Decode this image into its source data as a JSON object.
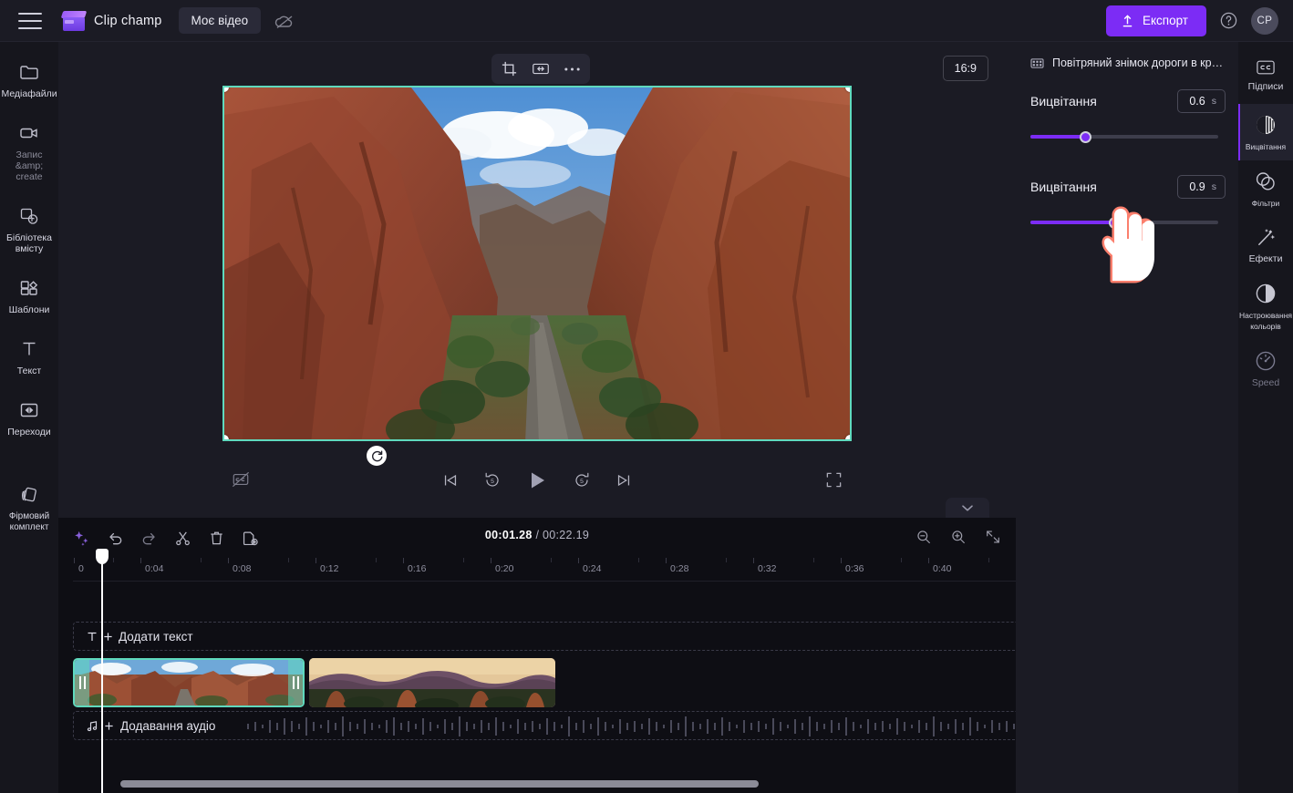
{
  "topbar": {
    "menu_icon": "hamburger-icon",
    "brand_name": "Clip champ",
    "project_name": "Моє відео",
    "cloud_icon": "cloud-off-icon",
    "export_label": "Експорт",
    "export_icon": "upload-icon",
    "help_icon": "help-circle-icon",
    "avatar_initials": "CP",
    "accent_color": "#7c2cf5"
  },
  "left_rail": {
    "items": [
      {
        "label": "Медіафайли",
        "icon": "folder-icon",
        "dim": false
      },
      {
        "label": "Запис &amp; create",
        "icon": "camera-video-icon",
        "dim": true
      },
      {
        "label": "Бібліотека вмісту",
        "icon": "content-library-icon",
        "dim": false
      },
      {
        "label": "Шаблони",
        "icon": "templates-icon",
        "dim": false
      },
      {
        "label": "Текст",
        "icon": "text-icon",
        "dim": false
      },
      {
        "label": "Переходи",
        "icon": "transitions-icon",
        "dim": false
      },
      {
        "label": "Фірмовий комплект",
        "icon": "brand-kit-icon",
        "dim": false
      }
    ],
    "expand_icon": "chevron-right-icon"
  },
  "preview": {
    "tools": [
      {
        "name": "crop-icon"
      },
      {
        "name": "fit-resize-icon"
      },
      {
        "name": "more-options-icon"
      }
    ],
    "aspect_ratio": "16:9",
    "rotate_icon": "rotate-icon",
    "captions_toggle_icon": "captions-off-icon",
    "controls": [
      {
        "name": "skip-to-start-icon"
      },
      {
        "name": "rewind-5s-icon"
      },
      {
        "name": "play-icon"
      },
      {
        "name": "forward-5s-icon"
      },
      {
        "name": "skip-to-end-icon"
      }
    ],
    "fullscreen_icon": "fullscreen-icon",
    "collapse_icon": "chevron-down-icon",
    "expand_icon": "chevron-right-icon",
    "selection_color": "#5fd9bd"
  },
  "timeline": {
    "tools_left": [
      {
        "name": "magic-ai-icon"
      },
      {
        "name": "undo-icon"
      },
      {
        "name": "redo-icon"
      },
      {
        "name": "split-scissors-icon"
      },
      {
        "name": "delete-trash-icon"
      },
      {
        "name": "duplicate-icon"
      }
    ],
    "current_time": "00:01.28",
    "separator": "/",
    "total_time": "00:22.19",
    "tools_right": [
      {
        "name": "zoom-out-icon"
      },
      {
        "name": "zoom-in-icon"
      },
      {
        "name": "fit-to-screen-icon"
      }
    ],
    "ruler_ticks": [
      "0",
      "0:04",
      "0:08",
      "0:12",
      "0:16",
      "0:20",
      "0:24",
      "0:28",
      "0:32",
      "0:36",
      "0:40"
    ],
    "text_track_label": "Додати текст",
    "text_track_icons": [
      "text-T-icon",
      "plus-icon"
    ],
    "audio_track_label": "Додавання аудіо",
    "audio_track_icons": [
      "music-note-icon",
      "plus-icon"
    ],
    "clips": [
      {
        "name": "video-clip-1",
        "selected": true
      },
      {
        "name": "video-clip-2",
        "selected": false
      }
    ]
  },
  "properties": {
    "header_icon": "film-strip-icon",
    "header_title": "Повітряний знімок дороги в красивих ...",
    "fields": [
      {
        "label": "Вицвітання",
        "value": "0.6",
        "unit": "s",
        "slider_percent": 29
      },
      {
        "label": "Вицвітання",
        "value": "0.9",
        "unit": "s",
        "slider_percent": 45
      }
    ],
    "slider_color": "#7c2cf5"
  },
  "right_rail": {
    "items": [
      {
        "label": "Підписи",
        "icon": "cc-captions-icon",
        "active": false,
        "dim": false,
        "small": false
      },
      {
        "label": "Вицвітання",
        "icon": "fade-icon",
        "active": true,
        "dim": false,
        "small": true
      },
      {
        "label": "Фільтри",
        "icon": "filters-icon",
        "active": false,
        "dim": false,
        "small": true
      },
      {
        "label": "Ефекти",
        "icon": "effects-wand-icon",
        "active": false,
        "dim": false,
        "small": false
      },
      {
        "label": "Настроювання кольорів",
        "icon": "color-adjust-icon",
        "active": false,
        "dim": false,
        "small": true
      },
      {
        "label": "Speed",
        "icon": "speedometer-icon",
        "active": false,
        "dim": true,
        "small": false
      }
    ]
  }
}
